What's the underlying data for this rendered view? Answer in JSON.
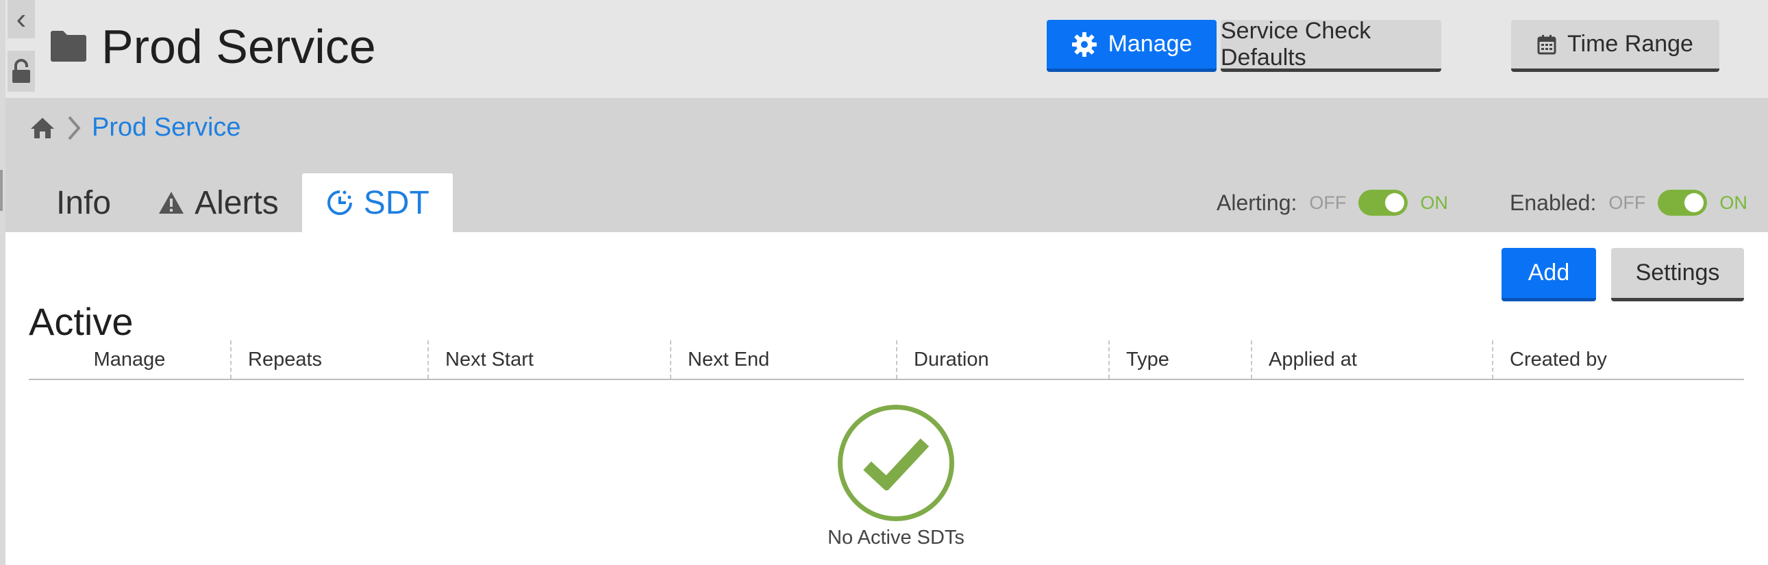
{
  "header": {
    "title": "Prod Service",
    "buttons": {
      "manage": "Manage",
      "service_check_defaults": "Service Check Defaults",
      "time_range": "Time Range"
    }
  },
  "breadcrumb": {
    "current": "Prod Service"
  },
  "tabs": [
    {
      "label": "Info"
    },
    {
      "label": "Alerts"
    },
    {
      "label": "SDT",
      "active": true
    }
  ],
  "toggles": {
    "alerting": {
      "label": "Alerting:",
      "off": "OFF",
      "on": "ON",
      "state": "on"
    },
    "enabled": {
      "label": "Enabled:",
      "off": "OFF",
      "on": "ON",
      "state": "on"
    }
  },
  "actions": {
    "add": "Add",
    "settings": "Settings"
  },
  "section": {
    "title": "Active"
  },
  "table": {
    "columns": [
      "Manage",
      "Repeats",
      "Next Start",
      "Next End",
      "Duration",
      "Type",
      "Applied at",
      "Created by"
    ]
  },
  "empty_state": {
    "text": "No Active SDTs"
  },
  "colors": {
    "primary": "#0a73f5",
    "link": "#1e7fe0",
    "toggle_on": "#7fb23d",
    "success": "#7fab48"
  }
}
